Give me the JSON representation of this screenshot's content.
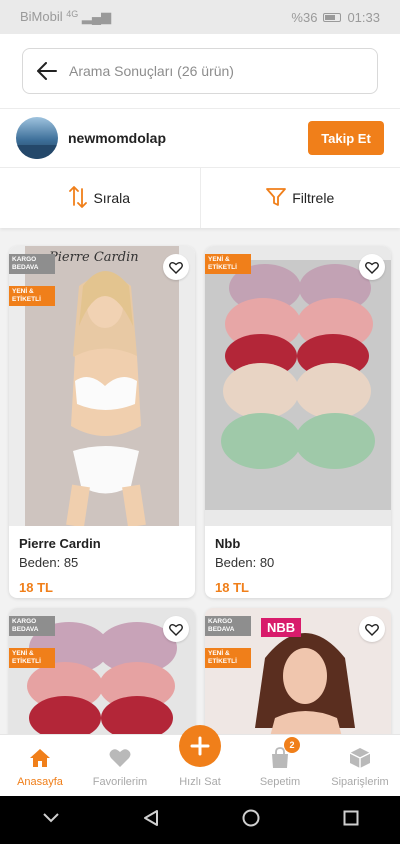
{
  "status_bar": {
    "carrier": "BiMobil",
    "signal": "4G",
    "battery_pct": "%36",
    "time": "01:33"
  },
  "search": {
    "text": "Arama Sonuçları (26 ürün)"
  },
  "shop": {
    "name": "newmomdolap",
    "follow_label": "Takip Et"
  },
  "controls": {
    "sort_label": "Sırala",
    "filter_label": "Filtrele"
  },
  "badges": {
    "free_shipping": "KARGO BEDAVA",
    "new_tagged": "YENİ & ETİKETLİ"
  },
  "size_label": "Beden:",
  "products": [
    {
      "name": "Pierre Cardin",
      "size": "85",
      "price": "18 TL",
      "kargo_bedava": true,
      "yeni_etiketli": true,
      "image_text": "Pierre Cardin"
    },
    {
      "name": "Nbb",
      "size": "80",
      "price": "18 TL",
      "kargo_bedava": false,
      "yeni_etiketli": true
    },
    {
      "name": "",
      "size": "",
      "price": "",
      "kargo_bedava": true,
      "yeni_etiketli": true
    },
    {
      "name": "",
      "size": "",
      "price": "",
      "kargo_bedava": true,
      "yeni_etiketli": true,
      "image_text": "NBB"
    }
  ],
  "bottom_nav": [
    {
      "label": "Anasayfa",
      "icon": "home-icon",
      "active": true
    },
    {
      "label": "Favorilerim",
      "icon": "heart-icon",
      "active": false
    },
    {
      "label": "Hızlı Sat",
      "icon": "plus-icon",
      "active": false
    },
    {
      "label": "Sepetim",
      "icon": "bag-icon",
      "active": false,
      "count": "2"
    },
    {
      "label": "Siparişlerim",
      "icon": "box-icon",
      "active": false
    }
  ],
  "colors": {
    "accent": "#f07f1a",
    "badge_gray": "#8e8e8e",
    "inactive": "#a9a9a9"
  }
}
